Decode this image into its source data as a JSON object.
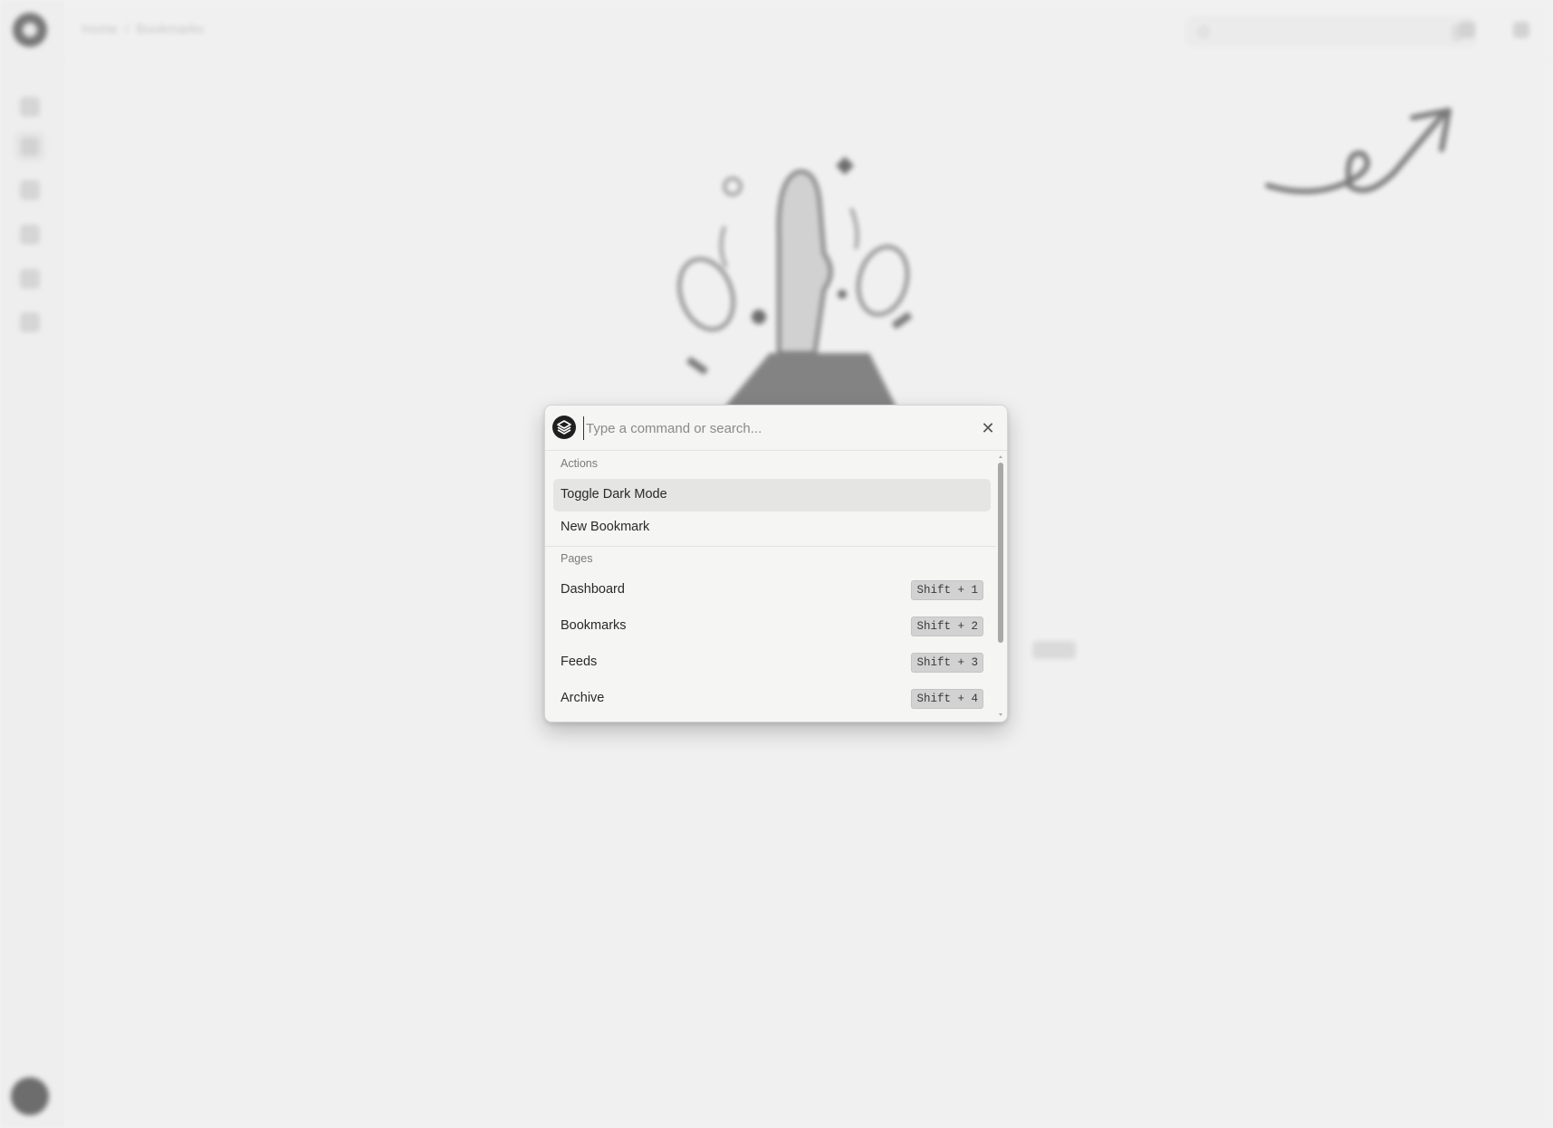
{
  "background": {
    "breadcrumb": [
      "Home",
      "Bookmarks"
    ],
    "breadcrumb_separator": "/"
  },
  "palette": {
    "input": {
      "placeholder": "Type a command or search...",
      "value": ""
    },
    "close_label": "✕",
    "groups": [
      {
        "heading": "Actions",
        "items": [
          {
            "label": "Toggle Dark Mode",
            "highlighted": true
          },
          {
            "label": "New Bookmark"
          }
        ]
      },
      {
        "heading": "Pages",
        "items": [
          {
            "label": "Dashboard",
            "shortcut": "Shift + 1"
          },
          {
            "label": "Bookmarks",
            "shortcut": "Shift + 2"
          },
          {
            "label": "Feeds",
            "shortcut": "Shift + 3"
          },
          {
            "label": "Archive",
            "shortcut": "Shift + 4"
          }
        ]
      }
    ]
  },
  "icons": {
    "sidebar": [
      "home-icon",
      "bookmark-icon",
      "rss-icon",
      "archive-icon",
      "calendar-icon",
      "tag-icon"
    ],
    "palette_logo": "layers-logo-icon",
    "close": "close-icon"
  },
  "colors": {
    "highlight": "#e5e5e4",
    "shortcut_bg": "#d2d2d2",
    "palette_bg": "#f5f5f4"
  }
}
